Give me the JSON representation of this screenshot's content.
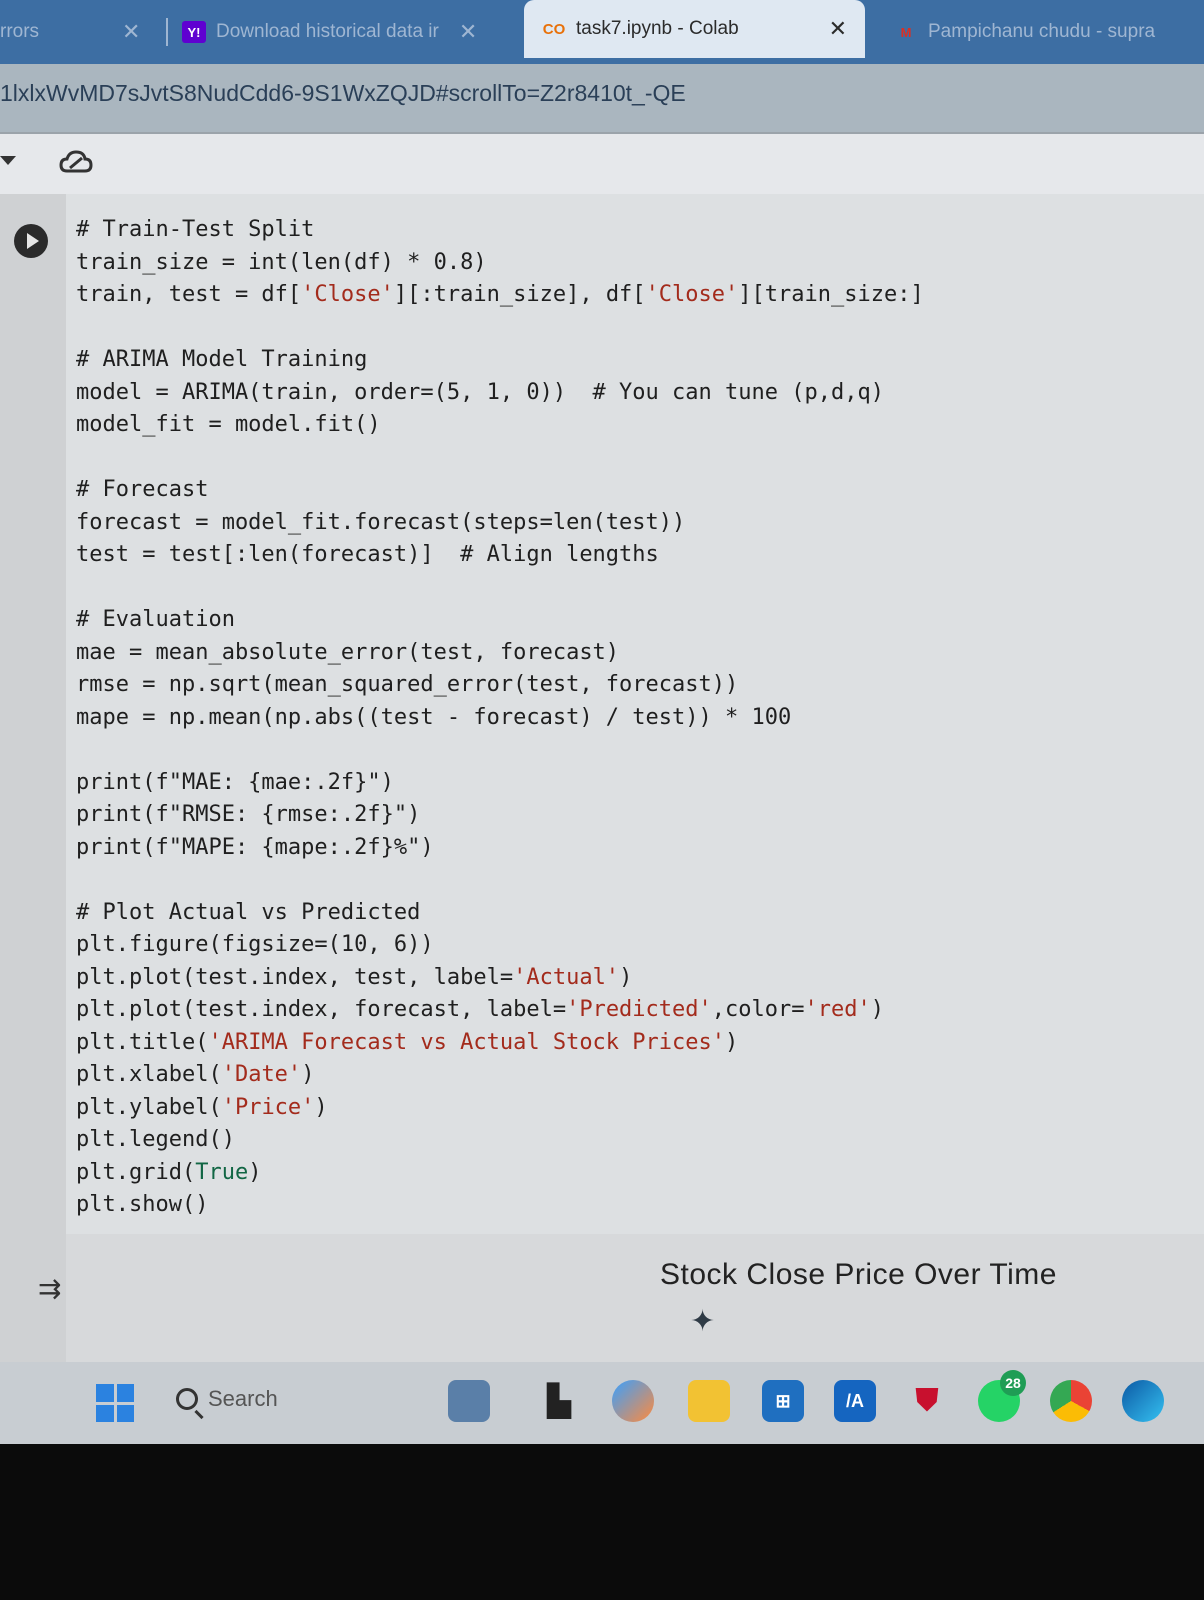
{
  "browser": {
    "tabs": [
      {
        "label": "rrors",
        "active": false
      },
      {
        "label": "Download historical data ir",
        "favicon": "Y!",
        "active": false
      },
      {
        "label": "task7.ipynb - Colab",
        "favicon": "CO",
        "active": true
      },
      {
        "label": "Pampichanu chudu - supra",
        "favicon": "M",
        "active": false
      }
    ],
    "url": "1lxlxWvMD7sJvtS8NudCdd6-9S1WxZQJD#scrollTo=Z2r8410t_-QE"
  },
  "colab": {
    "cloud_icon": "cloud-sync-icon"
  },
  "code_lines": [
    "# Train-Test Split",
    "train_size = int(len(df) * 0.8)",
    "train, test = df['Close'][:train_size], df['Close'][train_size:]",
    "",
    "# ARIMA Model Training",
    "model = ARIMA(train, order=(5, 1, 0))  # You can tune (p,d,q)",
    "model_fit = model.fit()",
    "",
    "# Forecast",
    "forecast = model_fit.forecast(steps=len(test))",
    "test = test[:len(forecast)]  # Align lengths",
    "",
    "# Evaluation",
    "mae = mean_absolute_error(test, forecast)",
    "rmse = np.sqrt(mean_squared_error(test, forecast))",
    "mape = np.mean(np.abs((test - forecast) / test)) * 100",
    "",
    "print(f\"MAE: {mae:.2f}\")",
    "print(f\"RMSE: {rmse:.2f}\")",
    "print(f\"MAPE: {mape:.2f}%\")",
    "",
    "# Plot Actual vs Predicted",
    "plt.figure(figsize=(10, 6))",
    "plt.plot(test.index, test, label='Actual')",
    "plt.plot(test.index, forecast, label='Predicted',color='red')",
    "plt.title('ARIMA Forecast vs Actual Stock Prices')",
    "plt.xlabel('Date')",
    "plt.ylabel('Price')",
    "plt.legend()",
    "plt.grid(True)",
    "plt.show()"
  ],
  "output": {
    "chart_title": "Stock Close Price Over Time"
  },
  "taskbar": {
    "search_label": "Search",
    "whatsapp_badge": "28"
  }
}
